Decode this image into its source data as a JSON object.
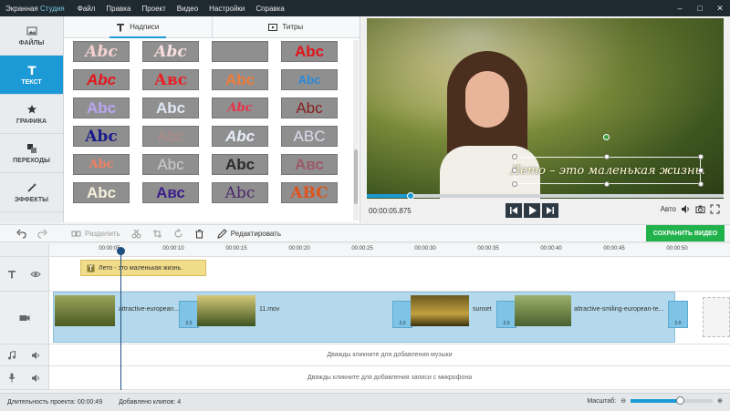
{
  "app": {
    "brand_main": "Экранная ",
    "brand_accent": "Студия",
    "menu": [
      "Файл",
      "Правка",
      "Проект",
      "Видео",
      "Настройки",
      "Справка"
    ]
  },
  "nav": {
    "items": [
      {
        "label": "ФАЙЛЫ"
      },
      {
        "label": "ТЕКСТ"
      },
      {
        "label": "ГРАФИКА"
      },
      {
        "label": "ПЕРЕХОДЫ"
      },
      {
        "label": "ЭФФЕКТЫ"
      }
    ]
  },
  "panel": {
    "tab_captions": "Надписи",
    "tab_titles": "Титры",
    "tiles": [
      "Abc",
      "Abc",
      "",
      "Abc",
      "Abc",
      "Авс",
      "Abc",
      "Abc",
      "Abc",
      "Abc",
      "Abc",
      "Abc",
      "Abc",
      "Abc",
      "Abc",
      "ABC",
      "Abc",
      "Abc",
      "Abc",
      "Авс",
      "Abc",
      "Авс",
      "Abc",
      "ABC"
    ]
  },
  "preview": {
    "caption": "Лето – это маленькая жизнь.",
    "timecode": "00:00:05.875",
    "progress_fraction": 0.123,
    "auto_label": "Авто"
  },
  "toolbar": {
    "split": "Разделить",
    "edit": "Редактировать",
    "save": "СОХРАНИТЬ ВИДЕО"
  },
  "timeline": {
    "ticks": [
      "00:00:05",
      "00:00:10",
      "00:00:15",
      "00:00:20",
      "00:00:25",
      "00:00:30",
      "00:00:35",
      "00:00:40",
      "00:00:45",
      "00:00:50"
    ],
    "text_clip": "Лето - это маленькая жизнь.",
    "clips": [
      "attractive-european...",
      "11.mov",
      "sunset",
      "attractive-smiling-european-te..."
    ],
    "transitions": [
      "2.0",
      "2.0",
      "2.0",
      "2.0",
      "2.0",
      "2.0"
    ],
    "music_hint": "Дважды кликните для добавления музыки",
    "mic_hint": "Дважды кликните для добавления записи с микрофона"
  },
  "status": {
    "duration": "Длительность проекта:  00:00:49",
    "clips_added": "Добавлено клипов: 4",
    "zoom_label": "Масштаб:",
    "zoom_fraction": 0.58
  },
  "colors": {
    "accent": "#1c9ad6",
    "save": "#22b24c",
    "menubar": "#1e2a30"
  }
}
